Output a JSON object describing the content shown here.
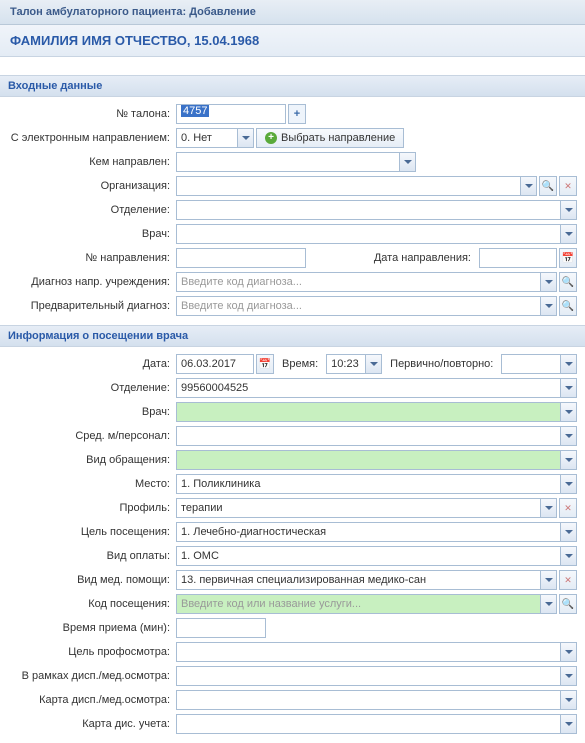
{
  "window": {
    "title": "Талон амбулаторного пациента: Добавление"
  },
  "patient": {
    "name": "ФАМИЛИЯ ИМЯ ОТЧЕСТВО, 15.04.1968"
  },
  "section1": {
    "title": "Входные данные",
    "talon_no_label": "№ талона:",
    "talon_no": "4757",
    "e_direction_label": "С электронным направлением:",
    "e_direction_value": "0. Нет",
    "select_direction_btn": "Выбрать направление",
    "referred_by_label": "Кем направлен:",
    "organization_label": "Организация:",
    "department_label": "Отделение:",
    "doctor_label": "Врач:",
    "direction_no_label": "№ направления:",
    "direction_date_label": "Дата направления:",
    "diag_inst_label": "Диагноз напр. учреждения:",
    "diag_placeholder": "Введите код диагноза...",
    "prelim_diag_label": "Предварительный диагноз:"
  },
  "section2": {
    "title": "Информация о посещении врача",
    "date_label": "Дата:",
    "date_value": "06.03.2017",
    "time_label": "Время:",
    "time_value": "10:23",
    "primary_label": "Первично/повторно:",
    "department_label": "Отделение:",
    "department_value": "99560004525",
    "doctor_label": "Врач:",
    "nurse_label": "Сред. м/персонал:",
    "visit_type_label": "Вид обращения:",
    "place_label": "Место:",
    "place_value": "1. Поликлиника",
    "profile_label": "Профиль:",
    "profile_value": "терапии",
    "visit_goal_label": "Цель посещения:",
    "visit_goal_value": "1. Лечебно-диагностическая",
    "payment_label": "Вид оплаты:",
    "payment_value": "1. ОМС",
    "med_help_label": "Вид мед. помощи:",
    "med_help_value": "13. первичная специализированная медико-сан",
    "visit_code_label": "Код посещения:",
    "visit_code_placeholder": "Введите код или название услуги...",
    "reception_time_label": "Время приема (мин):",
    "profsm_goal_label": "Цель профосмотра:",
    "disp_scope_label": "В рамках дисп./мед.осмотра:",
    "disp_card_label": "Карта дисп./мед.осмотра:",
    "disp_acct_card_label": "Карта дис. учета:"
  }
}
